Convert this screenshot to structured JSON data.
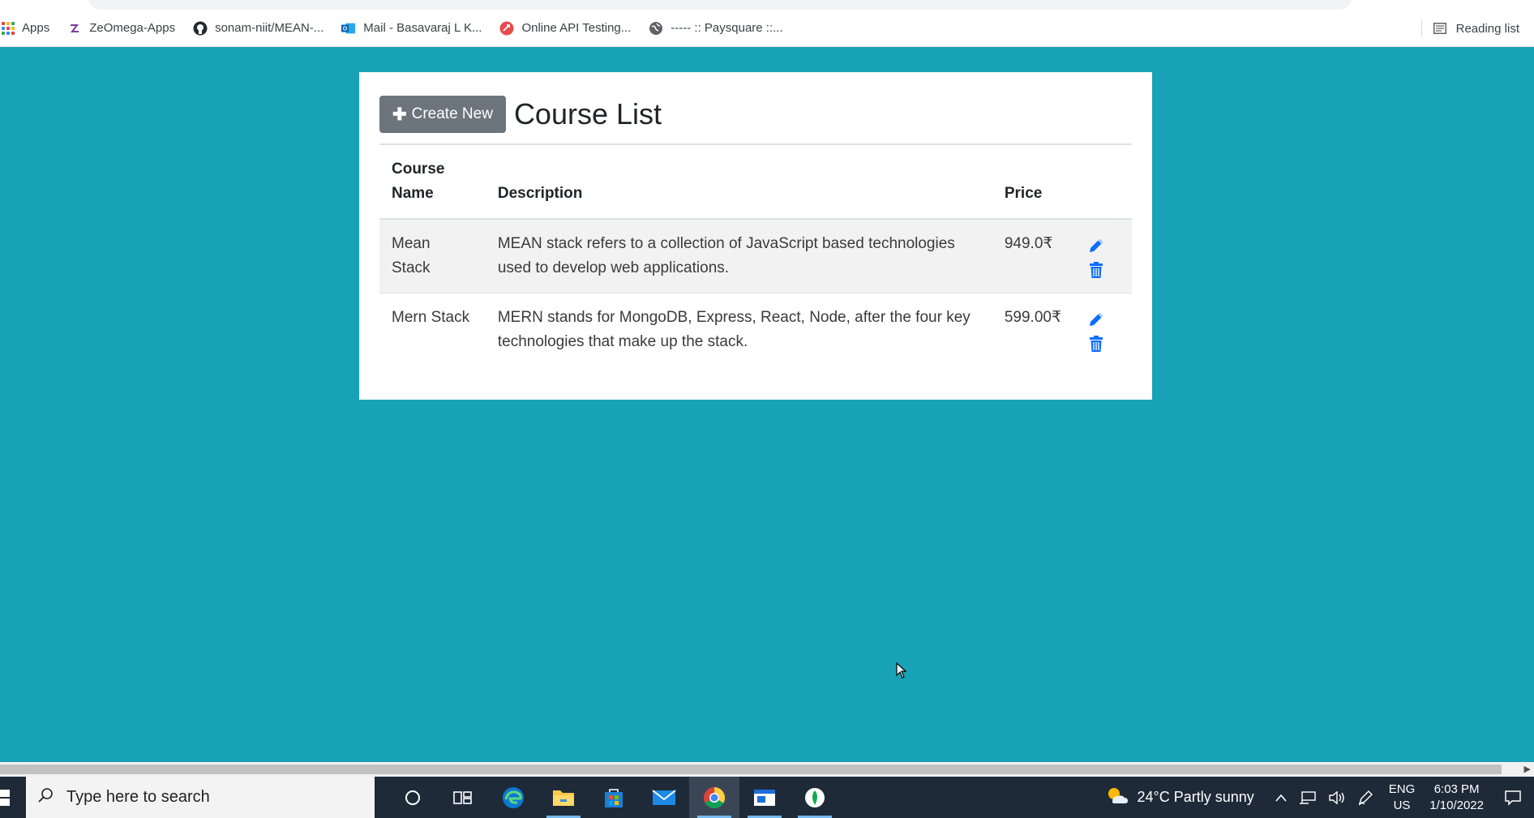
{
  "browser": {
    "bookmarks": [
      {
        "label": "Apps",
        "icon": "apps-grid-icon"
      },
      {
        "label": "ZeOmega-Apps",
        "icon": "zeomega-icon"
      },
      {
        "label": "sonam-niit/MEAN-...",
        "icon": "github-icon"
      },
      {
        "label": "Mail - Basavaraj L K...",
        "icon": "outlook-icon"
      },
      {
        "label": "Online API Testing...",
        "icon": "api-testing-icon"
      },
      {
        "label": "----- :: Paysquare ::...",
        "icon": "globe-icon"
      }
    ],
    "reading_list": "Reading list"
  },
  "page": {
    "create_button": "Create New",
    "title": "Course List",
    "columns": {
      "name_line1": "Course",
      "name_line2": "Name",
      "description": "Description",
      "price": "Price"
    },
    "courses": [
      {
        "name_line1": "Mean",
        "name_line2": "Stack",
        "description_line1": "MEAN stack refers to a collection of JavaScript based technologies",
        "description_line2": "used to develop web applications.",
        "price": "949.0₹"
      },
      {
        "name_line1": "Mern Stack",
        "name_line2": "",
        "description_line1": "MERN stands for MongoDB, Express, React, Node, after the four key",
        "description_line2": "technologies that make up the stack.",
        "price": "599.00₹"
      }
    ]
  },
  "taskbar": {
    "search_placeholder": "Type here to search",
    "weather": "24°C  Partly sunny",
    "lang_line1": "ENG",
    "lang_line2": "US",
    "time": "6:03 PM",
    "date": "1/10/2022"
  },
  "colors": {
    "background": "#17a2b8",
    "button_secondary": "#6c757d",
    "action_icon": "#0d6efd"
  }
}
